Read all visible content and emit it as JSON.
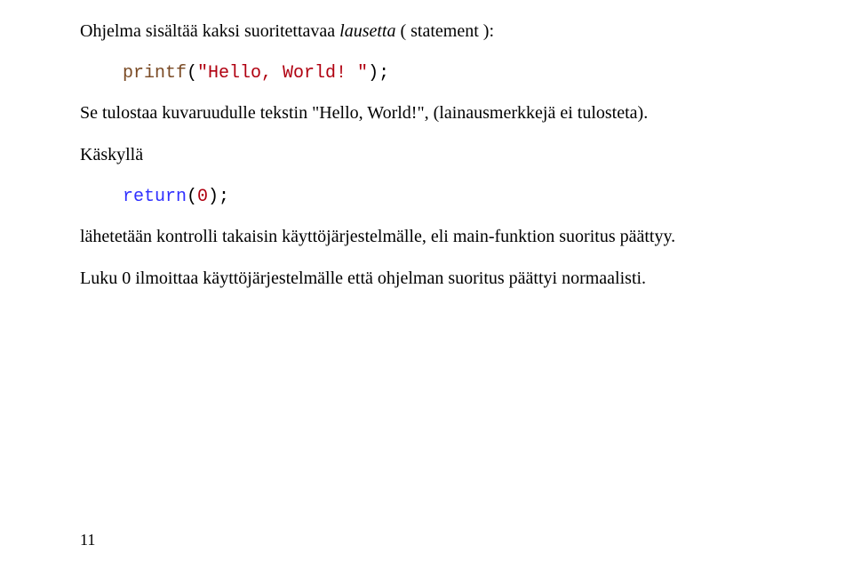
{
  "p1": {
    "t1": "Ohjelma sisältää kaksi suoritettavaa ",
    "italic": "lausetta",
    "t2": " ( statement ):"
  },
  "code1": {
    "func": "printf",
    "paren_open": "(",
    "str": "\"Hello, World! \"",
    "paren_close_semi": ");"
  },
  "p2": {
    "t1": "Se tulostaa kuvaruudulle tekstin \"Hello, World!\", (lainausmerkkejä ei tulosteta)."
  },
  "p3": {
    "t1": "Käskyllä"
  },
  "code2": {
    "kw": "return",
    "paren_open": "(",
    "num": "0",
    "paren_close_semi": ");"
  },
  "p4": {
    "t1": "lähetetään kontrolli takaisin käyttöjärjestelmälle, eli main-funktion suoritus päättyy."
  },
  "p5": {
    "t1": "Luku 0 ilmoittaa käyttöjärjestelmälle että ohjelman suoritus päättyi normaalisti."
  },
  "page_number": "11"
}
